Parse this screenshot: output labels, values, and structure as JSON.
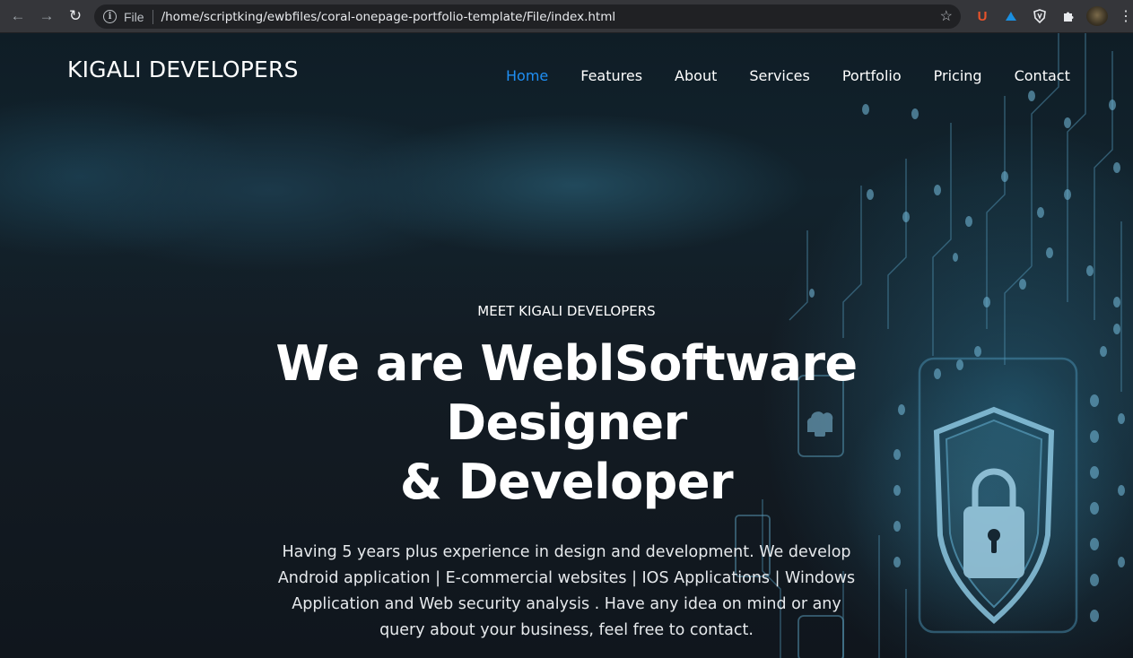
{
  "browser": {
    "file_label": "File",
    "url": "/home/scriptking/ewbfiles/coral-onepage-portfolio-template/File/index.html",
    "icons": [
      "back-arrow-icon",
      "forward-arrow-icon",
      "reload-icon",
      "info-icon",
      "star-icon",
      "ublock-icon",
      "extension-icon",
      "shield-icon",
      "puzzle-icon",
      "profile-avatar",
      "menu-icon"
    ]
  },
  "header": {
    "brand": "KIGALI DEVELOPERS",
    "nav": [
      {
        "label": "Home",
        "active": true
      },
      {
        "label": "Features",
        "active": false
      },
      {
        "label": "About",
        "active": false
      },
      {
        "label": "Services",
        "active": false
      },
      {
        "label": "Portfolio",
        "active": false
      },
      {
        "label": "Pricing",
        "active": false
      },
      {
        "label": "Contact",
        "active": false
      }
    ],
    "active_color": "#1f8ff4"
  },
  "hero": {
    "eyebrow": "MEET KIGALI DEVELOPERS",
    "headline_line1": "We are WeblSoftware",
    "headline_line2": "Designer",
    "headline_line3": "& Developer",
    "lead": "Having 5 years plus experience in design and development. We develop Android application | E-commercial websites | IOS Applications | Windows Application and Web security analysis . Have any idea on mind or any query about your business, feel free to contact."
  }
}
